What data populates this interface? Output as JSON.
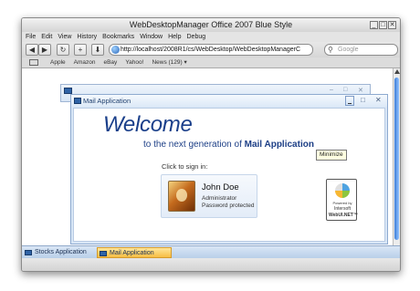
{
  "browser": {
    "title": "WebDesktopManager Office 2007 Blue Style",
    "menu": [
      "File",
      "Edit",
      "View",
      "History",
      "Bookmarks",
      "Window",
      "Help",
      "Debug"
    ],
    "url": "http://localhost/2008R1/cs/WebDesktop/WebDesktopManagerC",
    "search_placeholder": "Google",
    "bookmarks": [
      "Apple",
      "Amazon",
      "eBay",
      "Yahoo!",
      "News (129) ▾"
    ]
  },
  "toolbar": {
    "back": "◀",
    "forward": "▶",
    "reload": "↻",
    "add": "+",
    "download": "⬇"
  },
  "mail_window": {
    "title": "Mail Application",
    "welcome": "Welcome",
    "subtitle_prefix": "to the next generation of",
    "subtitle_app": "Mail Application",
    "click_to_sign_in": "Click to sign in:",
    "user": {
      "name": "John Doe",
      "role": "Administrator",
      "password_status": "Password protected"
    },
    "tooltip": "Minimize",
    "badge": {
      "line1": "Powered by",
      "line2": "Intersoft",
      "line3": "WebUI.NET™"
    }
  },
  "taskbar": {
    "items": [
      {
        "label": "Stocks Application",
        "active": false
      },
      {
        "label": "Mail Application",
        "active": true
      }
    ]
  }
}
